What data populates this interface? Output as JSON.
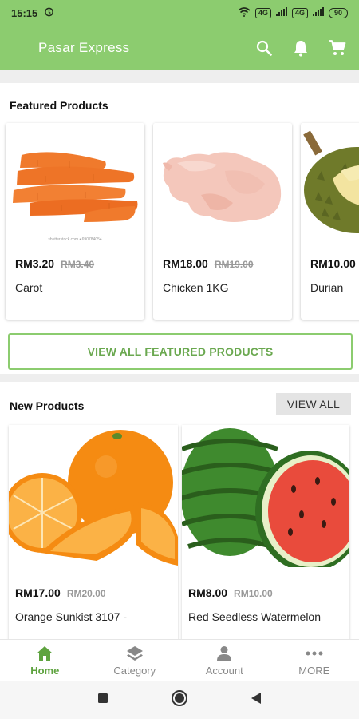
{
  "status_bar": {
    "time": "15:15",
    "alarm_icon": "alarm-icon",
    "indicators": [
      "wifi-icon",
      "volte-icon",
      "signal-icon",
      "volte-icon",
      "signal-icon"
    ],
    "chip_1": "4G",
    "chip_2": "4G",
    "battery": "90"
  },
  "app_bar": {
    "title": "Pasar Express",
    "actions": [
      "search-icon",
      "bell-icon",
      "cart-icon"
    ],
    "color": "#8ccc6f"
  },
  "featured": {
    "title": "Featured Products",
    "products": [
      {
        "price": "RM3.20",
        "old_price": "RM3.40",
        "name": "Carot",
        "image_caption": "shutterstock.com • 690784054"
      },
      {
        "price": "RM18.00",
        "old_price": "RM19.00",
        "name": "Chicken 1KG"
      },
      {
        "price": "RM10.00",
        "name": "Durian"
      }
    ],
    "view_all_label": "VIEW ALL FEATURED PRODUCTS"
  },
  "new_products": {
    "title": "New Products",
    "view_all_label": "VIEW ALL",
    "products": [
      {
        "price": "RM17.00",
        "old_price": "RM20.00",
        "name": "Orange Sunkist 3107 -"
      },
      {
        "price": "RM8.00",
        "old_price": "RM10.00",
        "name": "Red Seedless Watermelon"
      }
    ]
  },
  "bottom_nav": {
    "items": [
      {
        "label": "Home",
        "icon": "home-icon",
        "active": true
      },
      {
        "label": "Category",
        "icon": "layers-icon",
        "active": false
      },
      {
        "label": "Account",
        "icon": "person-icon",
        "active": false
      },
      {
        "label": "MORE",
        "icon": "more-dots-icon",
        "active": false
      }
    ],
    "active_color": "#5ea33f"
  },
  "system_nav": [
    "recents-square-icon",
    "home-circle-icon",
    "back-triangle-icon"
  ]
}
